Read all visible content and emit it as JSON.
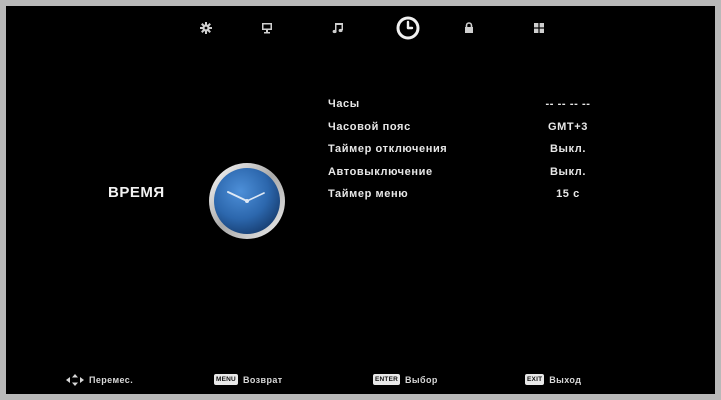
{
  "tabs": [
    {
      "id": "picture",
      "icon": "gear-icon",
      "active": false
    },
    {
      "id": "channel",
      "icon": "monitor-icon",
      "active": false
    },
    {
      "id": "sound",
      "icon": "music-note-icon",
      "active": false
    },
    {
      "id": "time",
      "icon": "clock-icon",
      "active": true
    },
    {
      "id": "lock",
      "icon": "lock-icon",
      "active": false
    },
    {
      "id": "setup",
      "icon": "grid-icon",
      "active": false
    }
  ],
  "category": {
    "label": "ВРЕМЯ",
    "icon": "clock-icon"
  },
  "settings": [
    {
      "label": "Часы",
      "value": "-- --  -- --"
    },
    {
      "label": "Часовой пояс",
      "value": "GMT+3"
    },
    {
      "label": "Таймер отключения",
      "value": "Выкл."
    },
    {
      "label": "Автовыключение",
      "value": "Выкл."
    },
    {
      "label": "Таймер меню",
      "value": "15 с"
    }
  ],
  "hints": [
    {
      "key_icon": "four-way-arrows-icon",
      "text": "Перемес."
    },
    {
      "key": "MENU",
      "text": "Возврат"
    },
    {
      "key": "ENTER",
      "text": "Выбор"
    },
    {
      "key": "EXIT",
      "text": "Выход"
    }
  ],
  "colors": {
    "background": "#000000",
    "frame": "#b9b9b9",
    "text": "#e8e8e8",
    "clock_face": "#2f6fb8",
    "clock_rim": "#d0d0d0"
  }
}
